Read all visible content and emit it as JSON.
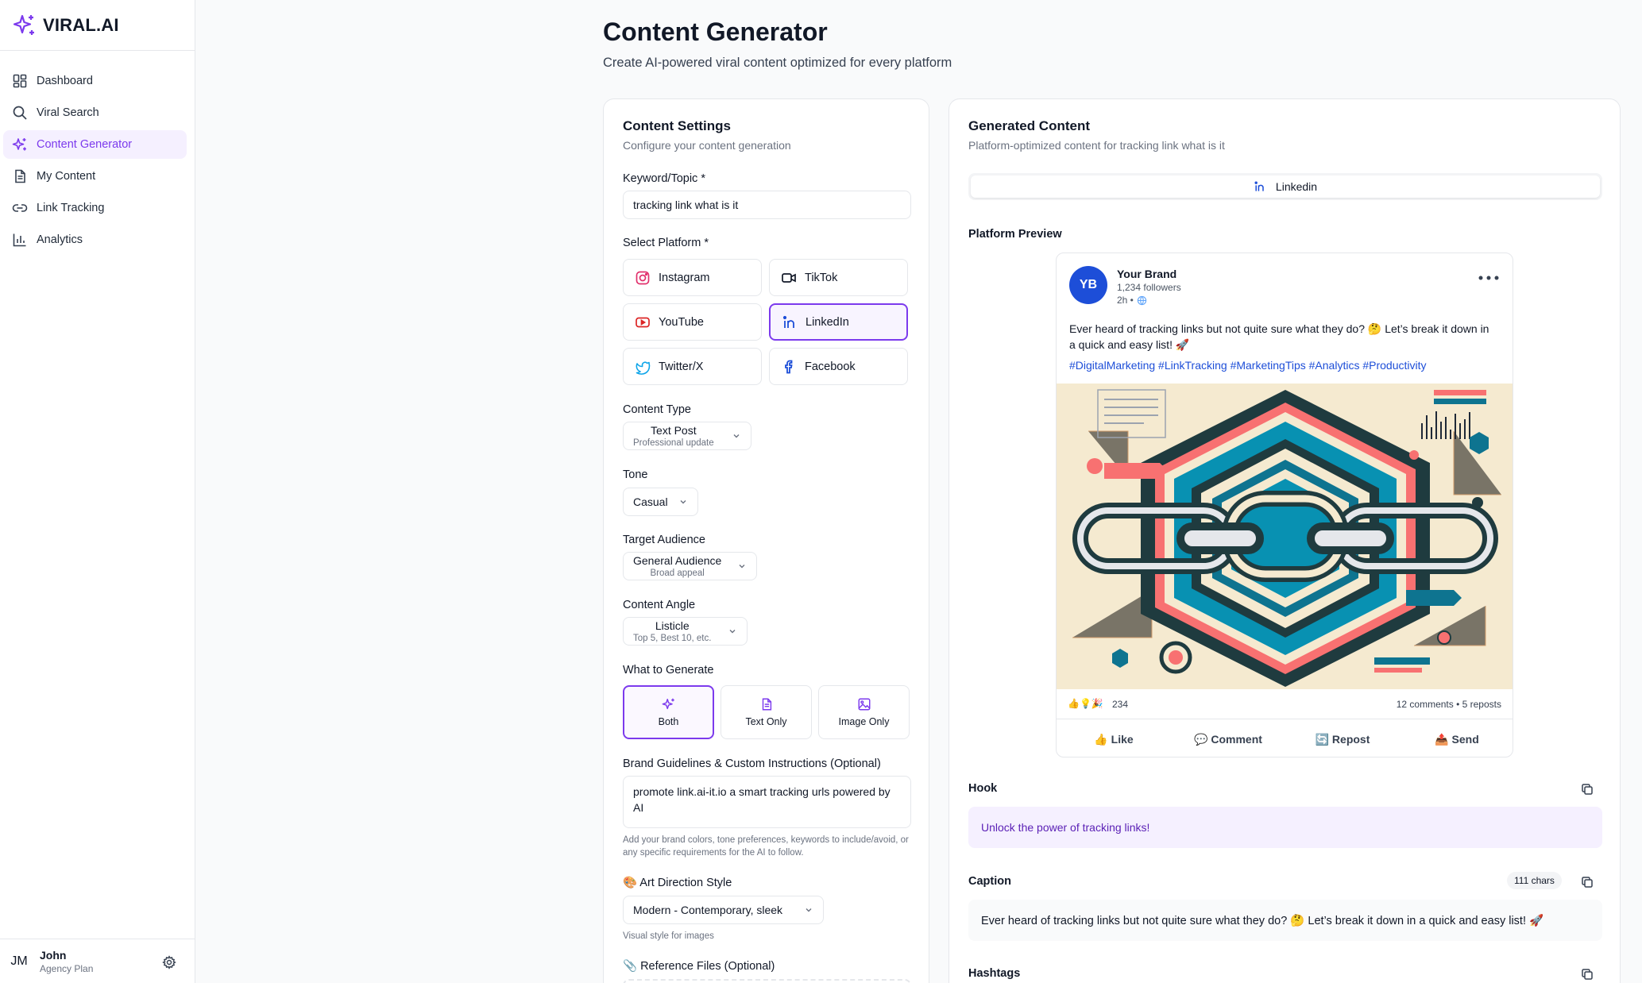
{
  "brand": {
    "name": "VIRAL.AI",
    "accent": "#7c3aed"
  },
  "sidebar": {
    "items": [
      {
        "label": "Dashboard",
        "icon": "dashboard-icon"
      },
      {
        "label": "Viral Search",
        "icon": "search-icon"
      },
      {
        "label": "Content Generator",
        "icon": "sparkles-icon",
        "active": true
      },
      {
        "label": "My Content",
        "icon": "document-icon"
      },
      {
        "label": "Link Tracking",
        "icon": "link-icon"
      },
      {
        "label": "Analytics",
        "icon": "bar-chart-icon"
      }
    ],
    "user": {
      "initials": "JM",
      "name": "John",
      "plan": "Agency Plan"
    }
  },
  "header": {
    "title": "Content Generator",
    "subtitle": "Create AI-powered viral content optimized for every platform"
  },
  "settings": {
    "title": "Content Settings",
    "subtitle": "Configure your content generation",
    "keyword_label": "Keyword/Topic *",
    "keyword_value": "tracking link what is it",
    "platform_label": "Select Platform *",
    "platforms": [
      "Instagram",
      "TikTok",
      "YouTube",
      "LinkedIn",
      "Twitter/X",
      "Facebook"
    ],
    "selected_platform": "LinkedIn",
    "content_type_label": "Content Type",
    "content_type": {
      "main": "Text Post",
      "sub": "Professional update"
    },
    "tone_label": "Tone",
    "tone": "Casual",
    "audience_label": "Target Audience",
    "audience": {
      "main": "General Audience",
      "sub": "Broad appeal"
    },
    "angle_label": "Content Angle",
    "angle": {
      "main": "Listicle",
      "sub": "Top 5, Best 10, etc."
    },
    "generate_label": "What to Generate",
    "generate_options": [
      "Both",
      "Text Only",
      "Image Only"
    ],
    "guidelines_label": "Brand Guidelines & Custom Instructions (Optional)",
    "guidelines_value": "promote link.ai-it.io a smart tracking urls powered by AI",
    "guidelines_help": "Add your brand colors, tone preferences, keywords to include/avoid, or any specific requirements for the AI to follow.",
    "art_label": "🎨 Art Direction Style",
    "art_value": "Modern - Contemporary, sleek",
    "art_help": "Visual style for images",
    "reference_label": "📎 Reference Files (Optional)"
  },
  "generated": {
    "title": "Generated Content",
    "subtitle": "Platform-optimized content for tracking link what is it",
    "tab": "Linkedin",
    "preview_label": "Platform Preview",
    "post": {
      "avatar": "YB",
      "author": "Your Brand",
      "followers": "1,234 followers",
      "time": "2h •",
      "text": "Ever heard of tracking links but not quite sure what they do? 🤔 Let’s break it down in a quick and easy list! 🚀",
      "hashtags": "#DigitalMarketing #LinkTracking #MarketingTips #Analytics #Productivity",
      "reactions_emoji": "👍💡🎉",
      "reactions": "234",
      "comments_reposts": "12 comments • 5 reposts",
      "actions": [
        "👍 Like",
        "💬 Comment",
        "🔄 Repost",
        "📤 Send"
      ]
    },
    "hook_label": "Hook",
    "hook": "Unlock the power of tracking links!",
    "caption_label": "Caption",
    "caption_chars": "111 chars",
    "caption": "Ever heard of tracking links but not quite sure what they do? 🤔 Let’s break it down in a quick and easy list! 🚀",
    "hashtags_label": "Hashtags"
  }
}
